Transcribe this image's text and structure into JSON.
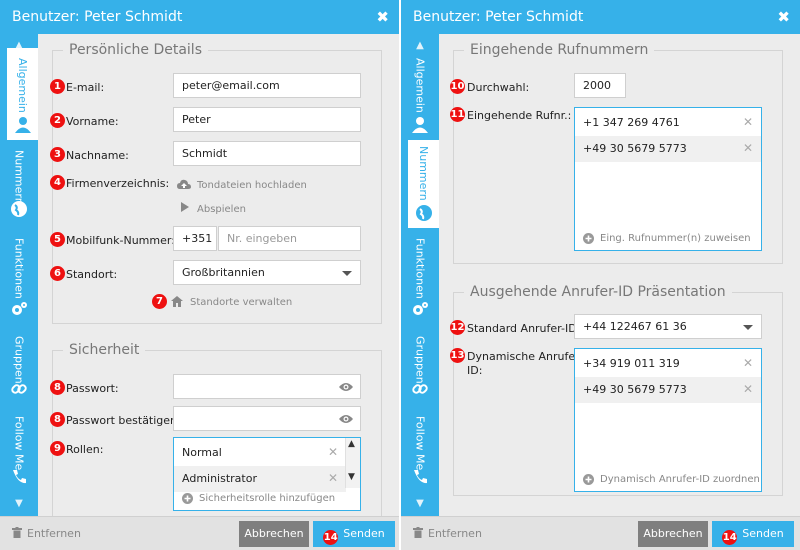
{
  "left": {
    "title": "Benutzer: Peter Schmidt",
    "tabs": [
      "Allgemein",
      "Nummern",
      "Funktionen",
      "Gruppen",
      "Follow Me"
    ],
    "personal": {
      "legend": "Persönliche Details",
      "email_label": "E-mail:",
      "email_value": "peter@email.com",
      "firstname_label": "Vorname:",
      "firstname_value": "Peter",
      "lastname_label": "Nachname:",
      "lastname_value": "Schmidt",
      "directory_label": "Firmenverzeichnis:",
      "upload_label": "Tondateien hochladen",
      "play_label": "Abspielen",
      "mobile_label": "Mobilfunk-Nummer:",
      "mobile_prefix": "+351",
      "mobile_placeholder": "Nr. eingeben",
      "location_label": "Standort:",
      "location_value": "Großbritannien",
      "manage_label": "Standorte verwalten"
    },
    "security": {
      "legend": "Sicherheit",
      "password_label": "Passwort:",
      "confirm_label": "Passwort bestätigen:",
      "roles_label": "Rollen:",
      "roles": [
        "Normal",
        "Administrator"
      ],
      "add_role_label": "Sicherheitsrolle hinzufügen"
    },
    "footer": {
      "remove": "Entfernen",
      "cancel": "Abbrechen",
      "send": "Senden"
    }
  },
  "right": {
    "title": "Benutzer: Peter Schmidt",
    "tabs": [
      "Allgemein",
      "Nummern",
      "Funktionen",
      "Gruppen",
      "Follow Me"
    ],
    "incoming": {
      "legend": "Eingehende Rufnummern",
      "extension_label": "Durchwahl:",
      "extension_value": "2000",
      "numbers_label": "Eingehende Rufnr.:",
      "numbers": [
        "+1 347 269 4761",
        "+49 30 5679 5773"
      ],
      "assign_label": "Eing. Rufnummer(n) zuweisen"
    },
    "outgoing": {
      "legend": "Ausgehende Anrufer-ID Präsentation",
      "standard_label": "Standard Anrufer-ID:",
      "standard_value": "+44 122467 61 36",
      "dynamic_label_1": "Dynamische Anrufer-",
      "dynamic_label_2": "ID:",
      "dynamic_numbers": [
        "+34 919 011 319",
        "+49 30 5679 5773"
      ],
      "dynamic_assign_label": "Dynamisch Anrufer-ID zuordnen"
    },
    "footer": {
      "remove": "Entfernen",
      "cancel": "Abbrechen",
      "send": "Senden"
    }
  },
  "badges": [
    "1",
    "2",
    "3",
    "4",
    "5",
    "6",
    "7",
    "8",
    "8",
    "9",
    "10",
    "11",
    "12",
    "13",
    "14",
    "14"
  ],
  "colors": {
    "accent": "#36b1e9",
    "badge": "#ee1111",
    "cancel": "#7f7f7f"
  }
}
